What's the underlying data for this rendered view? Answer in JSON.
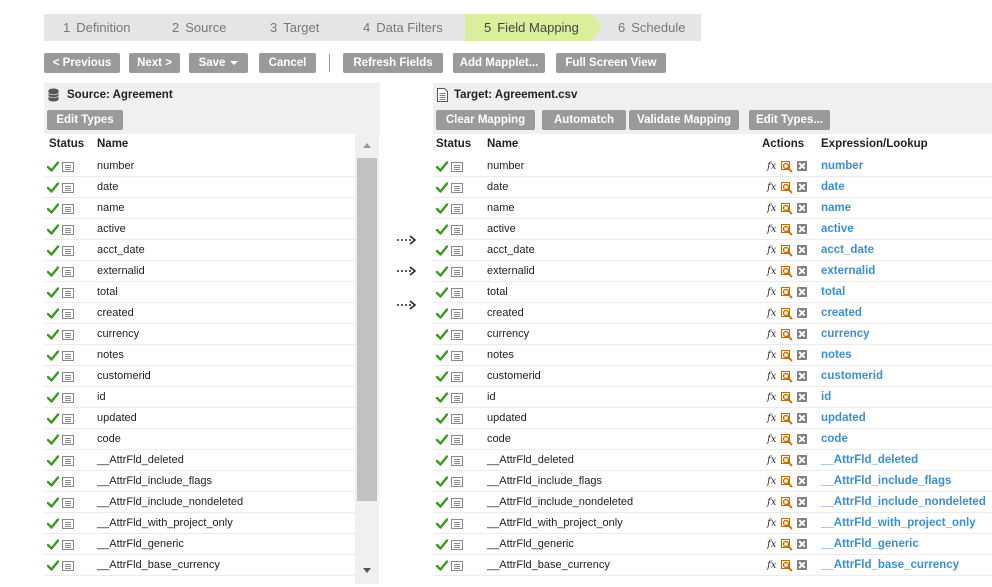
{
  "wizard": {
    "steps": [
      {
        "num": "1",
        "label": "Definition"
      },
      {
        "num": "2",
        "label": "Source"
      },
      {
        "num": "3",
        "label": "Target"
      },
      {
        "num": "4",
        "label": "Data Filters"
      },
      {
        "num": "5",
        "label": "Field Mapping"
      },
      {
        "num": "6",
        "label": "Schedule"
      }
    ],
    "active_step": 5
  },
  "toolbar": {
    "previous": "< Previous",
    "next": "Next >",
    "save": "Save",
    "cancel": "Cancel",
    "refresh_fields": "Refresh Fields",
    "add_mapplet": "Add Mapplet...",
    "full_screen": "Full Screen View"
  },
  "source": {
    "title": "Source: Agreement",
    "edit_types": "Edit Types",
    "col_status": "Status",
    "col_name": "Name",
    "fields": [
      "number",
      "date",
      "name",
      "active",
      "acct_date",
      "externalid",
      "total",
      "created",
      "currency",
      "notes",
      "customerid",
      "id",
      "updated",
      "code",
      "__AttrFld_deleted",
      "__AttrFld_include_flags",
      "__AttrFld_include_nondeleted",
      "__AttrFld_with_project_only",
      "__AttrFld_generic",
      "__AttrFld_base_currency"
    ]
  },
  "target": {
    "title": "Target: Agreement.csv",
    "clear_mapping": "Clear Mapping",
    "automatch": "Automatch",
    "validate_mapping": "Validate Mapping",
    "edit_types": "Edit Types...",
    "col_status": "Status",
    "col_name": "Name",
    "col_actions": "Actions",
    "col_expression": "Expression/Lookup",
    "fx_label": "fx",
    "fields": [
      "number",
      "date",
      "name",
      "active",
      "acct_date",
      "externalid",
      "total",
      "created",
      "currency",
      "notes",
      "customerid",
      "id",
      "updated",
      "code",
      "__AttrFld_deleted",
      "__AttrFld_include_flags",
      "__AttrFld_include_nondeleted",
      "__AttrFld_with_project_only",
      "__AttrFld_generic",
      "__AttrFld_base_currency"
    ],
    "expressions": [
      "number",
      "date",
      "name",
      "active",
      "acct_date",
      "externalid",
      "total",
      "created",
      "currency",
      "notes",
      "customerid",
      "id",
      "updated",
      "code",
      "__AttrFld_deleted",
      "__AttrFld_include_flags",
      "__AttrFld_include_nondeleted",
      "__AttrFld_with_project_only",
      "__AttrFld_generic",
      "__AttrFld_base_currency"
    ]
  },
  "icons": {
    "status_ok": "check-icon",
    "field_note": "note-icon",
    "lookup": "lookup-icon",
    "delete": "delete-icon",
    "source_db": "database-icon",
    "target_file": "document-icon",
    "map_arrow": "dotted-arrow-icon"
  },
  "colors": {
    "active_step": "#dbee9c",
    "button": "#9a9a9a",
    "link": "#3b8fd4",
    "check": "#3a9a1e"
  }
}
